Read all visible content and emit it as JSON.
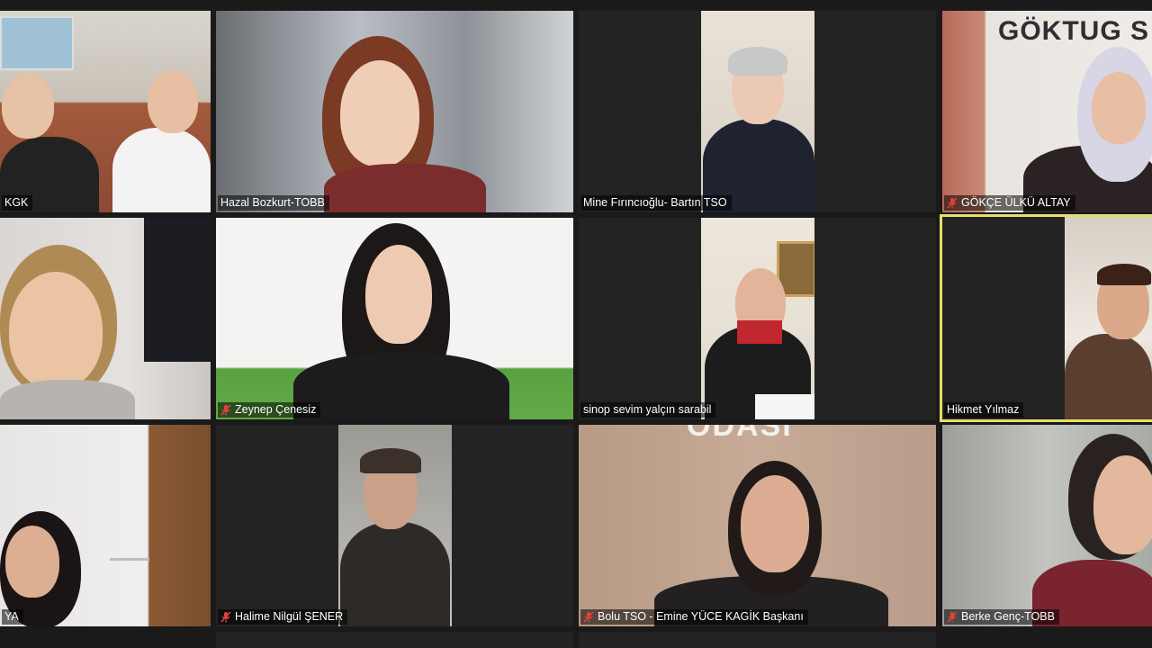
{
  "participants": [
    {
      "name": "KGK",
      "muted": false
    },
    {
      "name": "Hazal Bozkurt-TOBB",
      "muted": false
    },
    {
      "name": "Mine Fırıncıoğlu- Bartın TSO",
      "muted": false
    },
    {
      "name": "GÖKÇE ÜLKÜ ALTAY",
      "muted": true
    },
    {
      "name": "",
      "muted": false
    },
    {
      "name": "Zeynep Çenesiz",
      "muted": true
    },
    {
      "name": "sinop sevim yalçın sarabil",
      "muted": false
    },
    {
      "name": "Hikmet Yılmaz",
      "muted": false,
      "active_speaker": true
    },
    {
      "name": "YA",
      "muted": false
    },
    {
      "name": "Halime Nilgül ŞENER",
      "muted": true
    },
    {
      "name": "Bolu TSO - Emine YÜCE KAGİK Başkanı",
      "muted": true
    },
    {
      "name": "Berke Genç-TOBB",
      "muted": true
    }
  ],
  "backgrounds": {
    "sign_text": "GÖKTUG S",
    "wall_text": "ODASI"
  },
  "colors": {
    "active_border": "#e3e06a",
    "muted_icon": "#e0413a",
    "tile_bg": "#232323"
  }
}
